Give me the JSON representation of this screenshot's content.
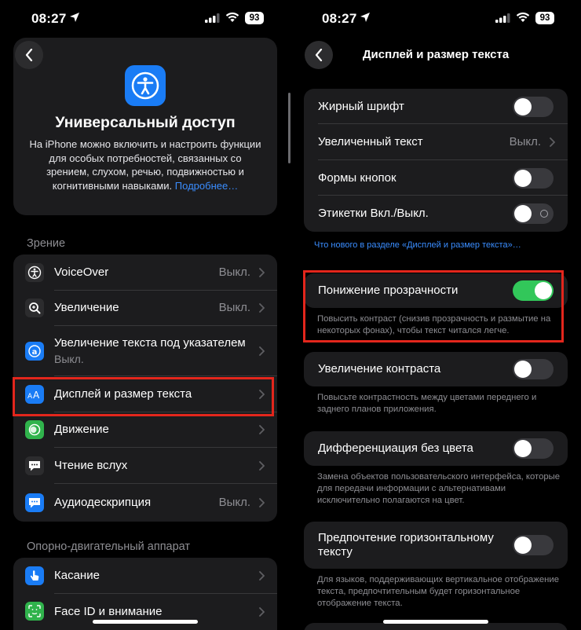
{
  "status": {
    "time": "08:27",
    "battery": "93"
  },
  "left": {
    "hero": {
      "title": "Универсальный доступ",
      "description": "На iPhone можно включить и настроить функции для особых потребностей, связанных со зрением, слухом, речью, подвижностью и когнитивными навыками.",
      "more_link": "Подробнее…"
    },
    "sections": {
      "vision": "Зрение",
      "motor": "Опорно-двигательный аппарат"
    },
    "vision_items": [
      {
        "label": "VoiceOver",
        "value": "Выкл."
      },
      {
        "label": "Увеличение",
        "value": "Выкл."
      },
      {
        "label": "Увеличение текста под указателем",
        "value": "Выкл."
      },
      {
        "label": "Дисплей и размер текста",
        "value": ""
      },
      {
        "label": "Движение",
        "value": ""
      },
      {
        "label": "Чтение вслух",
        "value": ""
      },
      {
        "label": "Аудиодескрипция",
        "value": "Выкл."
      }
    ],
    "motor_items": [
      {
        "label": "Касание"
      },
      {
        "label": "Face ID и внимание"
      }
    ]
  },
  "right": {
    "title": "Дисплей и размер текста",
    "group1": [
      {
        "label": "Жирный шрифт",
        "on": false
      },
      {
        "label": "Увеличенный текст",
        "value": "Выкл."
      },
      {
        "label": "Формы кнопок",
        "on": false
      },
      {
        "label": "Этикетки Вкл./Выкл.",
        "on": false
      }
    ],
    "whats_new_link": "Что нового в разделе «Дисплей и размер текста»…",
    "reduce_transparency": {
      "label": "Понижение прозрачности",
      "on": true,
      "note": "Повысить контраст (снизив прозрачность и размытие на некоторых фонах), чтобы текст читался легче."
    },
    "increase_contrast": {
      "label": "Увеличение контраста",
      "on": false,
      "note": "Повысьте контрастность между цветами переднего и заднего планов приложения."
    },
    "differentiate": {
      "label": "Дифференциация без цвета",
      "on": false,
      "note": "Замена объектов пользовательского интерфейса, которые для передачи информации с альтернативами исключительно полагаются на цвет."
    },
    "horizontal_text": {
      "label": "Предпочтение горизонтальному тексту",
      "on": false,
      "note": "Для языков, поддерживающих вертикальное отображение текста, предпочтительным будет горизонтальное отображение текста."
    }
  },
  "colors": {
    "accent": "#3a8dff",
    "toggle_on": "#32c75a",
    "highlight": "#e3261c",
    "group_bg": "#1c1c1e"
  },
  "icons": {
    "accessibility": "accessibility-figure-icon",
    "voiceover": "voiceover-icon",
    "zoom": "zoom-magnifier-icon",
    "hover_text": "hover-text-icon",
    "display_text": "text-size-aa-icon",
    "motion": "motion-icon",
    "spoken": "speech-bubble-icon",
    "audio_desc": "audio-description-icon",
    "touch": "hand-touch-icon",
    "faceid": "face-id-icon"
  }
}
